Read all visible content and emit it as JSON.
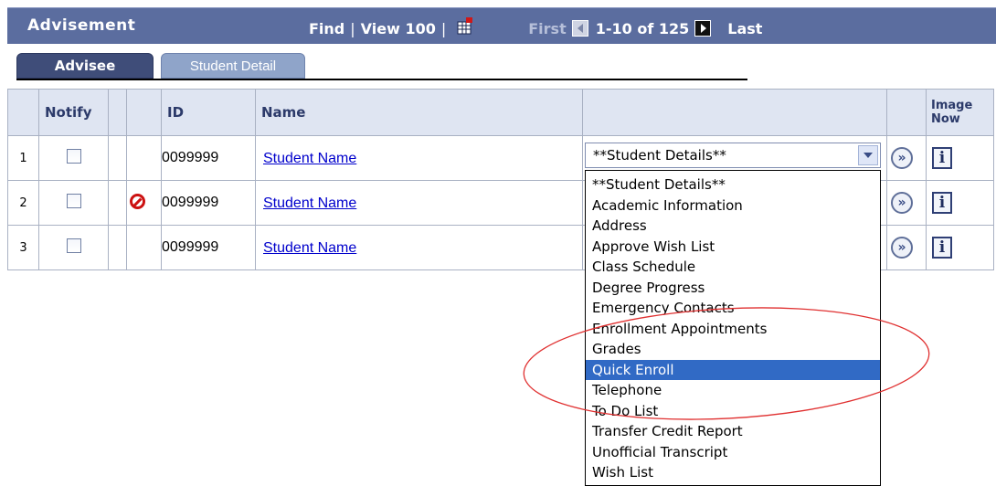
{
  "header": {
    "title": "Advisement",
    "find": "Find",
    "view": "View 100",
    "first": "First",
    "range": "1-10 of 125",
    "last": "Last"
  },
  "tabs": [
    {
      "label": "Advisee",
      "active": true
    },
    {
      "label": "Student Detail",
      "active": false
    }
  ],
  "grid": {
    "columns": [
      "Notify",
      "ID",
      "Name",
      "Image Now"
    ],
    "rows": [
      {
        "num": "1",
        "id": "0099999",
        "name": "Student Name",
        "blocked": false
      },
      {
        "num": "2",
        "id": "0099999",
        "name": "Student Name",
        "blocked": true
      },
      {
        "num": "3",
        "id": "0099999",
        "name": "Student Name",
        "blocked": false
      }
    ]
  },
  "select": {
    "value": "**Student Details**",
    "options": [
      "**Student Details**",
      "Academic Information",
      "Address",
      "Approve Wish List",
      "Class Schedule",
      "Degree Progress",
      "Emergency Contacts",
      "Enrollment Appointments",
      "Grades",
      "Quick Enroll",
      "Telephone",
      "To Do List",
      "Transfer Credit Report",
      "Unofficial Transcript",
      "Wish List"
    ],
    "highlighted": "Quick Enroll"
  },
  "colors": {
    "header_bg": "#5b6d9f",
    "tab_active": "#3f4d79",
    "tab_inactive": "#8fa4c9",
    "link": "#0000cc",
    "highlight": "#316ac5",
    "annotation": "#e03030"
  }
}
